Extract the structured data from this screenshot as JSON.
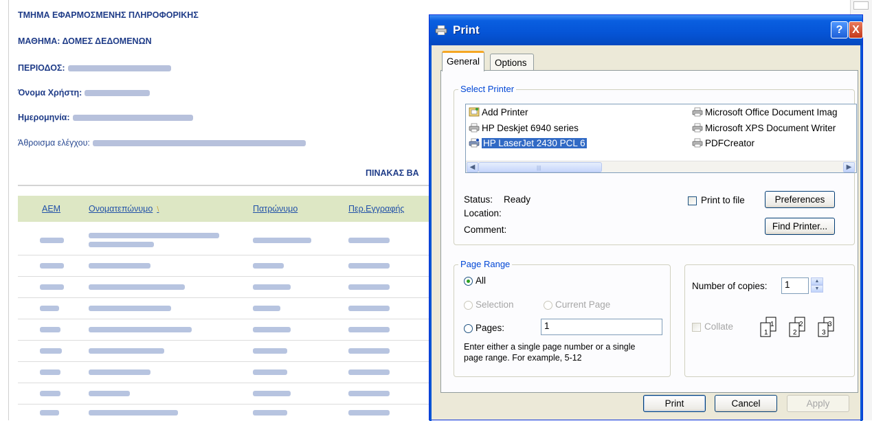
{
  "background_page": {
    "header_lines": [
      {
        "label": "ΤΜΗΜΑ ΕΦΑΡΜΟΣΜΕΝΗΣ ΠΛΗΡΟΦΟΡΙΚΗΣ"
      },
      {
        "label": "ΜΑΘΗΜΑ: ΔΟΜΕΣ ΔΕΔΟΜΕΝΩΝ"
      },
      {
        "label": "ΠΕΡΙΟΔΟΣ:"
      },
      {
        "label": "Όνομα Χρήστη:"
      },
      {
        "label": "Ημερομηνία:"
      },
      {
        "label": "Άθροισμα ελέγχου:"
      }
    ],
    "page_title": "ΠΙΝΑΚΑΣ ΒΑ",
    "table": {
      "headers": [
        "ΑΕΜ",
        "Ονοματεπώνυμο",
        "Πατρώνυμο",
        "Περ.Εγγραφής"
      ],
      "sort_icon": "sort-arrow-icon",
      "row_count": 9
    }
  },
  "dialog": {
    "title": "Print",
    "title_buttons": {
      "help": "?",
      "close": "X"
    },
    "tabs": [
      {
        "label": "General",
        "active": true
      },
      {
        "label": "Options",
        "active": false
      }
    ],
    "select_printer": {
      "legend": "Select Printer",
      "printers": [
        {
          "name": "Add Printer",
          "icon": "add-printer-icon",
          "selected": false
        },
        {
          "name": "HP Deskjet 6940 series",
          "icon": "printer-icon",
          "selected": false
        },
        {
          "name": "HP LaserJet 2430 PCL 6",
          "icon": "default-printer-icon",
          "selected": true
        },
        {
          "name": "Microsoft Office Document Imag",
          "icon": "printer-icon",
          "selected": false
        },
        {
          "name": "Microsoft XPS Document Writer",
          "icon": "printer-icon",
          "selected": false
        },
        {
          "name": "PDFCreator",
          "icon": "printer-icon",
          "selected": false
        }
      ],
      "status_label": "Status:",
      "status_value": "Ready",
      "location_label": "Location:",
      "location_value": "",
      "comment_label": "Comment:",
      "comment_value": "",
      "print_to_file": {
        "label": "Print to file",
        "checked": false
      },
      "preferences_button": "Preferences",
      "find_printer_button": "Find Printer..."
    },
    "page_range": {
      "legend": "Page Range",
      "all": {
        "label": "All",
        "selected": true
      },
      "selection": {
        "label": "Selection",
        "enabled": false
      },
      "current_page": {
        "label": "Current Page",
        "enabled": false
      },
      "pages": {
        "label": "Pages:",
        "value": "1"
      },
      "hint": [
        "Enter either a single page number or a single",
        "page range.  For example, 5-12"
      ]
    },
    "copies": {
      "label": "Number of copies:",
      "value": "1",
      "collate": {
        "label": "Collate",
        "checked": false,
        "enabled": false
      },
      "collate_pages": [
        "1",
        "1",
        "2",
        "2",
        "3",
        "3"
      ]
    },
    "buttons": {
      "print": "Print",
      "cancel": "Cancel",
      "apply": "Apply"
    },
    "colors": {
      "titlebar": "#0554d6",
      "selection": "#316ac5",
      "dialog_bg": "#ece9d8",
      "group_title": "#0046d5"
    }
  }
}
